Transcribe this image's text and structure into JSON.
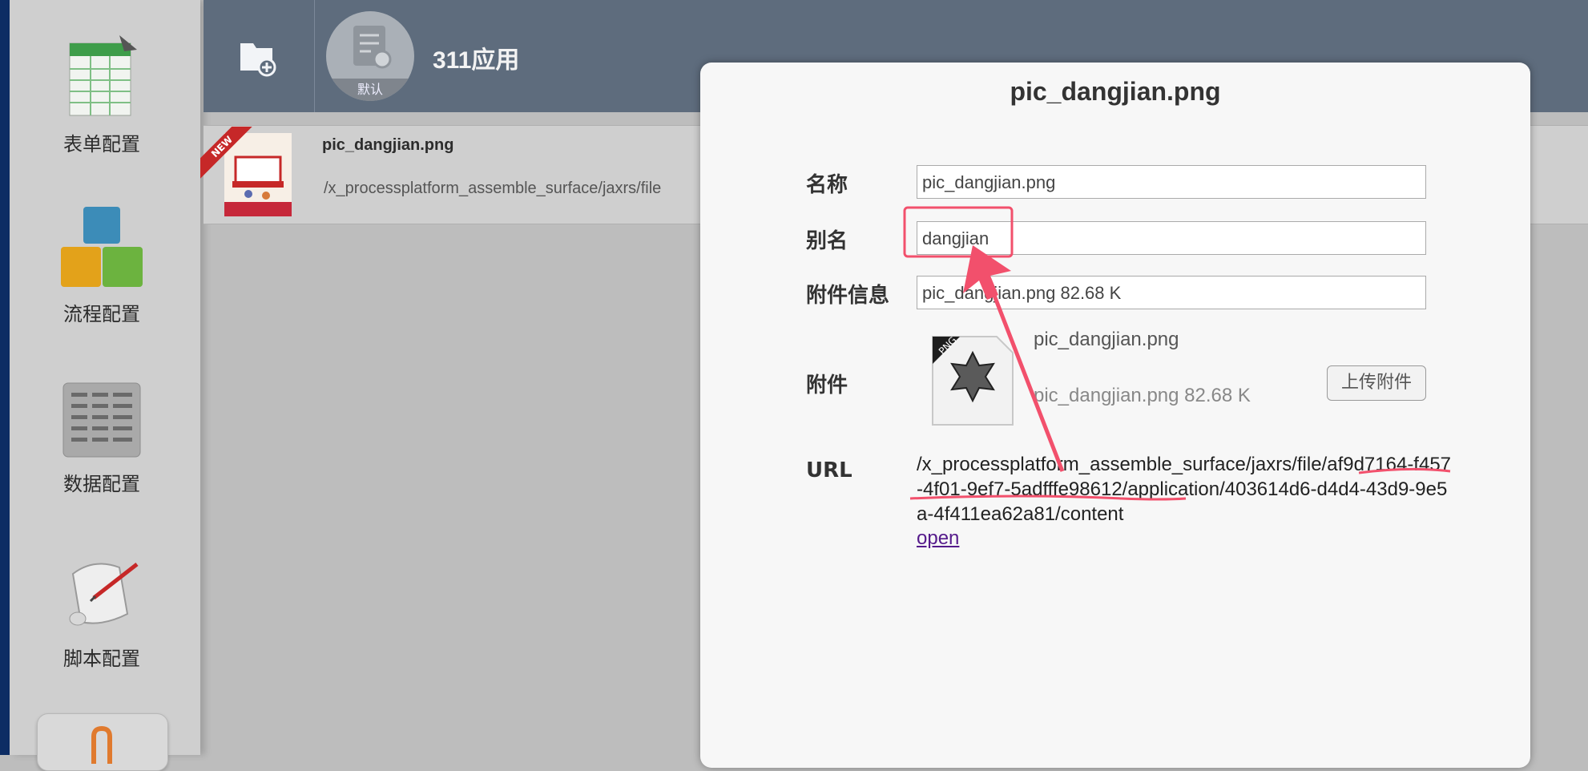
{
  "sidebar": {
    "items": [
      {
        "label": "表单配置",
        "icon": "form-table-icon"
      },
      {
        "label": "流程配置",
        "icon": "process-blocks-icon"
      },
      {
        "label": "数据配置",
        "icon": "data-sheet-icon"
      },
      {
        "label": "脚本配置",
        "icon": "script-scroll-icon"
      }
    ],
    "active_icon": "attachment-icon"
  },
  "header": {
    "app_title": "311应用",
    "app_badge": "默认",
    "folder_icon": "add-folder-icon"
  },
  "file_list": {
    "badge": "NEW",
    "name": "pic_dangjian.png",
    "path": "/x_processplatform_assemble_surface/jaxrs/file"
  },
  "dialog": {
    "title": "pic_dangjian.png",
    "fields": {
      "name_label": "名称",
      "name_value": "pic_dangjian.png",
      "alias_label": "别名",
      "alias_value": "dangjian",
      "info_label": "附件信息",
      "info_value": "pic_dangjian.png 82.68 K",
      "attachment_label": "附件",
      "url_label": "URL"
    },
    "attachment": {
      "icon_text": "PNG",
      "name": "pic_dangjian.png",
      "size": "pic_dangjian.png 82.68 K",
      "upload_label": "上传附件"
    },
    "url": {
      "value": "/x_processplatform_assemble_surface/jaxrs/file/af9d7164-f457-4f01-9ef7-5adfffe98612/application/403614d6-d4d4-43d9-9e5a-4f411ea62a81/content",
      "link_text": "open"
    }
  },
  "colors": {
    "topbar": "#5e6c7d",
    "annotation": "#f2506c",
    "link": "#551a8b"
  }
}
